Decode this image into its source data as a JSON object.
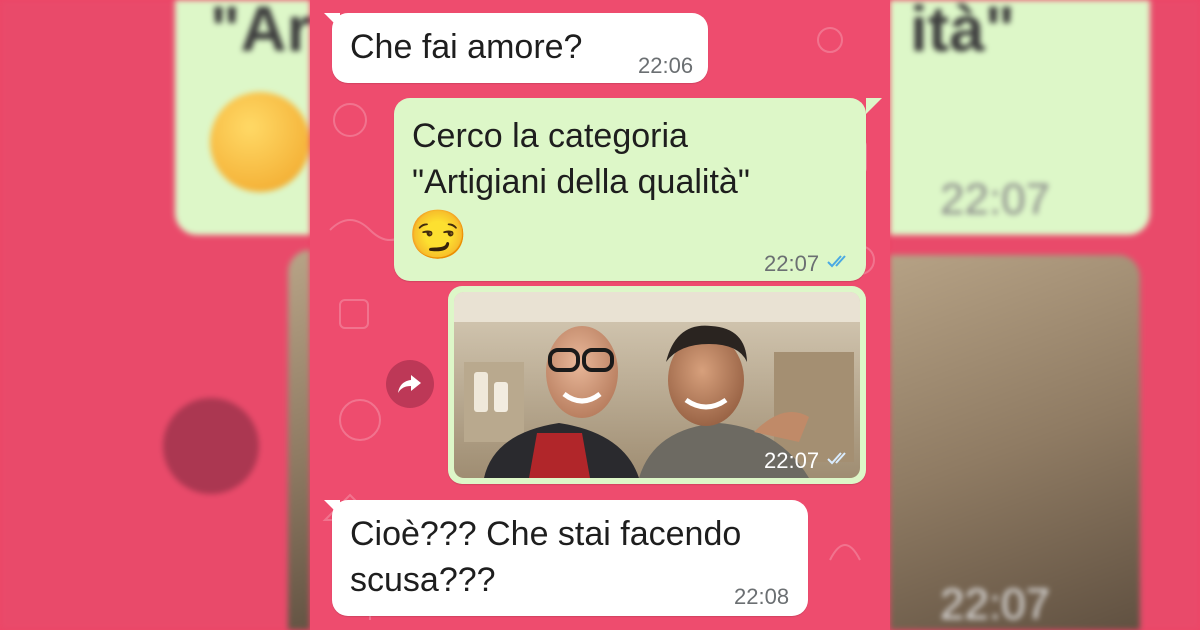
{
  "messages": [
    {
      "direction": "incoming",
      "text": "Che fai amore?",
      "time": "22:06"
    },
    {
      "direction": "outgoing",
      "line1": "Cerco la categoria",
      "line2": "\"Artigiani della qualità\"",
      "emoji": "😏",
      "time": "22:07",
      "status": "read"
    },
    {
      "direction": "outgoing",
      "type": "image",
      "time": "22:07",
      "status": "read"
    },
    {
      "direction": "incoming",
      "line1": "Cioè??? Che stai facendo",
      "line2": "scusa???",
      "time": "22:08"
    }
  ],
  "icons": {
    "forward": "forward-arrow-icon",
    "read_ticks": "double-check-icon"
  },
  "colors": {
    "background": "#ee4c6e",
    "incoming_bubble": "#ffffff",
    "outgoing_bubble": "#ddf7c8",
    "read_tick": "#4aa9e3"
  }
}
